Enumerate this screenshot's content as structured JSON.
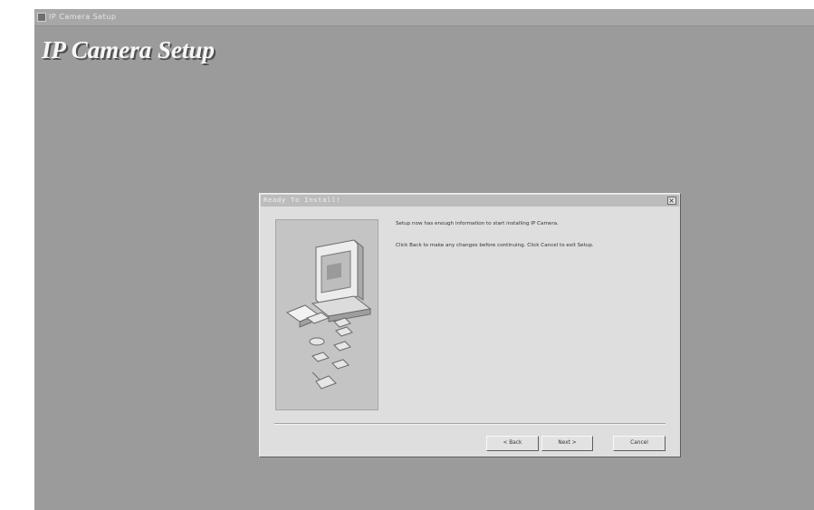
{
  "window": {
    "title": "IP Camera Setup",
    "brand": "IP Camera Setup"
  },
  "dialog": {
    "title": "Ready To Install!",
    "close_glyph": "×",
    "message_ready": "Setup now has enough information to start installing IP Camera.",
    "message_back": "Click Back to make any changes before continuing. Click Cancel to exit Setup.",
    "buttons": {
      "back": "< Back",
      "next": "Next >",
      "cancel": "Cancel"
    }
  },
  "icons": {
    "app": "app-icon",
    "close": "close-icon",
    "installer_art": "computer-with-disks-illustration"
  }
}
